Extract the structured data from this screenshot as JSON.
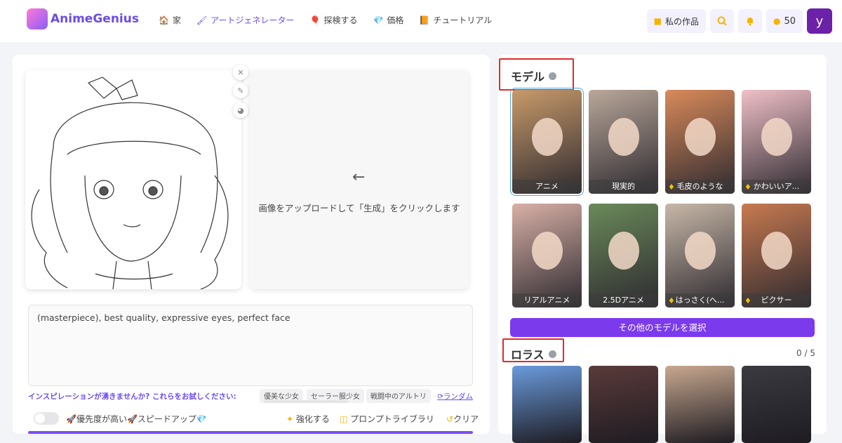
{
  "header": {
    "logo_text": "AnimeGenius",
    "nav": [
      {
        "icon": "🏠",
        "label": "家"
      },
      {
        "icon": "🖌",
        "label": "アートジェネレーター"
      },
      {
        "icon": "🎈",
        "label": "探検する"
      },
      {
        "icon": "💎",
        "label": "価格"
      },
      {
        "icon": "📙",
        "label": "チュートリアル"
      }
    ],
    "my_works_label": "私の作品",
    "credits": "50",
    "avatar_letter": "y"
  },
  "editor": {
    "upload_hint": "画像をアップロードして「生成」をクリックします",
    "arrow": "←",
    "prompt_value": "(masterpiece), best quality, expressive eyes, perfect face",
    "inspiration_label": "インスピレーションが湧きませんか? これらをお試しください:",
    "suggestions": [
      "優美な少女",
      "セーラー服少女",
      "戦闘中のアルトリ"
    ],
    "random_label": "ランダム",
    "priority_label": "🚀優先度が高い🚀スピードアップ",
    "enhance_label": "強化する",
    "library_label": "プロンプトライブラリ",
    "clear_label": "クリア"
  },
  "models": {
    "title": "モデル",
    "items": [
      {
        "label": "アニメ",
        "premium": false,
        "color": "#c89a6a"
      },
      {
        "label": "現実的",
        "premium": false,
        "color": "#b9a79a"
      },
      {
        "label": "毛皮のような",
        "premium": true,
        "color": "#d98a5a"
      },
      {
        "label": "かわいいア...",
        "premium": true,
        "color": "#f0c0c8"
      },
      {
        "label": "リアルアニメ",
        "premium": false,
        "color": "#d8b0a6"
      },
      {
        "label": "2.5Dアニメ",
        "premium": false,
        "color": "#6a8a5a"
      },
      {
        "label": "はっさく(へ...",
        "premium": true,
        "color": "#c8b8a8"
      },
      {
        "label": "ピクサー",
        "premium": true,
        "color": "#c87a50"
      }
    ],
    "select_more": "その他のモデルを選択"
  },
  "lora": {
    "title": "ロラス",
    "count": "0 / 5",
    "items": [
      {
        "color": "#6a9adc"
      },
      {
        "color": "#5a3a3a"
      },
      {
        "color": "#c8a890"
      },
      {
        "color": "#3a3a40"
      }
    ]
  }
}
